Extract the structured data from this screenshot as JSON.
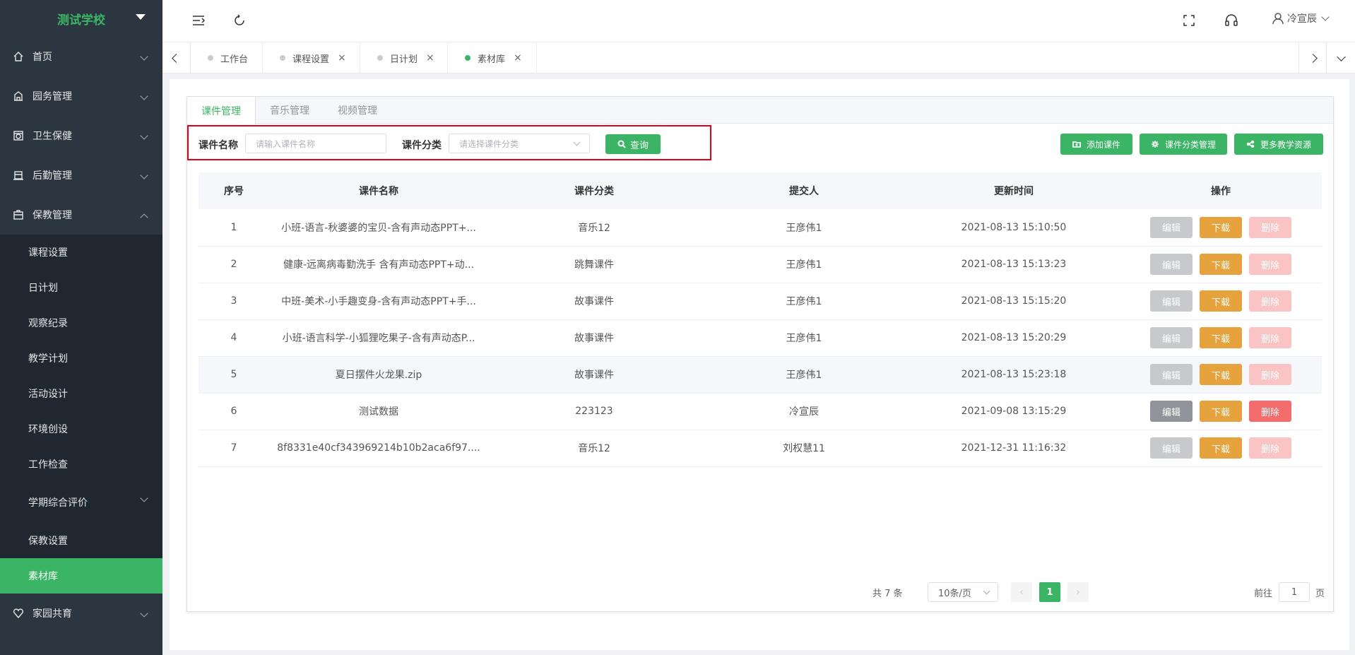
{
  "sidebar": {
    "school": "测试学校",
    "menus": [
      {
        "label": "首页"
      },
      {
        "label": "园务管理"
      },
      {
        "label": "卫生保健"
      },
      {
        "label": "后勤管理"
      },
      {
        "label": "保教管理"
      }
    ],
    "sub_items": [
      {
        "label": "课程设置"
      },
      {
        "label": "日计划"
      },
      {
        "label": "观察纪录"
      },
      {
        "label": "教学计划"
      },
      {
        "label": "活动设计"
      },
      {
        "label": "环境创设"
      },
      {
        "label": "工作检查"
      },
      {
        "label": "学期综合评价"
      },
      {
        "label": "保教设置"
      },
      {
        "label": "素材库"
      }
    ],
    "last_menu": "家园共育"
  },
  "header": {
    "user": "冷宣辰"
  },
  "tabs": [
    {
      "label": "工作台"
    },
    {
      "label": "课程设置",
      "close": "×"
    },
    {
      "label": "日计划",
      "close": "×"
    },
    {
      "label": "素材库",
      "close": "×"
    }
  ],
  "card": {
    "tabs": [
      "课件管理",
      "音乐管理",
      "视频管理"
    ],
    "filter": {
      "name_label": "课件名称",
      "name_placeholder": "请输入课件名称",
      "cat_label": "课件分类",
      "cat_placeholder": "请选择课件分类",
      "query": "查询"
    },
    "actions": {
      "add": "添加课件",
      "category": "课件分类管理",
      "more": "更多教学资源"
    },
    "columns": [
      "序号",
      "课件名称",
      "课件分类",
      "提交人",
      "更新时间",
      "操作"
    ],
    "rows": [
      {
        "no": "1",
        "name": "小班-语言-秋婆婆的宝贝-含有声动态PPT+...",
        "cat": "音乐12",
        "by": "王彦伟1",
        "time": "2021-08-13 15:10:50"
      },
      {
        "no": "2",
        "name": "健康-远离病毒勤洗手 含有声动态PPT+动...",
        "cat": "跳舞课件",
        "by": "王彦伟1",
        "time": "2021-08-13 15:13:23"
      },
      {
        "no": "3",
        "name": "中班-美术-小手趣变身-含有声动态PPT+手...",
        "cat": "故事课件",
        "by": "王彦伟1",
        "time": "2021-08-13 15:15:20"
      },
      {
        "no": "4",
        "name": "小班-语言科学-小狐狸吃果子-含有声动态P...",
        "cat": "故事课件",
        "by": "王彦伟1",
        "time": "2021-08-13 15:20:29"
      },
      {
        "no": "5",
        "name": "夏日摆件火龙果.zip",
        "cat": "故事课件",
        "by": "王彦伟1",
        "time": "2021-08-13 15:23:18"
      },
      {
        "no": "6",
        "name": "测试数据",
        "cat": "223123",
        "by": "冷宣辰",
        "time": "2021-09-08 13:15:29"
      },
      {
        "no": "7",
        "name": "8f8331e40cf343969214b10b2aca6f97....",
        "cat": "音乐12",
        "by": "刘权慧11",
        "time": "2021-12-31 11:16:32"
      }
    ],
    "op_labels": {
      "edit": "编辑",
      "download": "下载",
      "delete": "删除"
    },
    "pager": {
      "total": "共 7 条",
      "size": "10条/页",
      "current": "1",
      "goto": "前往",
      "goto_value": "1",
      "page_unit": "页"
    }
  }
}
